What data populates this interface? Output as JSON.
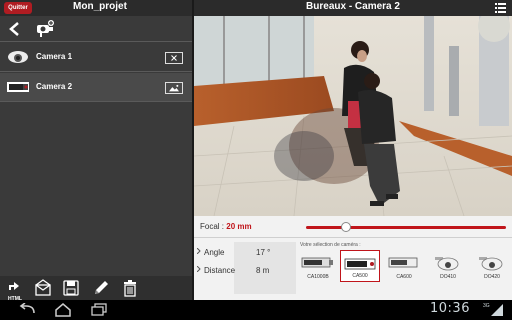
{
  "left_panel": {
    "quit_label": "Quitter",
    "project_title": "Mon_projet",
    "cameras": [
      {
        "name": "Camera 1",
        "icon": "dome-camera-icon",
        "action_icon": "close-box-icon"
      },
      {
        "name": "Camera 2",
        "icon": "bullet-camera-icon",
        "action_icon": "image-icon"
      }
    ],
    "bottom_tools": [
      {
        "icon": "html-export-icon",
        "label": "HTML"
      },
      {
        "icon": "email-icon"
      },
      {
        "icon": "save-icon"
      },
      {
        "icon": "pencil-icon"
      },
      {
        "icon": "trash-icon"
      }
    ]
  },
  "right_panel": {
    "title": "Bureaux - Camera 2",
    "focal": {
      "label": "Focal :",
      "value": "20 mm",
      "slider_fraction": 0.2
    },
    "params": [
      {
        "label": "Angle",
        "value": "17 °"
      },
      {
        "label": "Distance",
        "value": "8 m"
      }
    ],
    "camera_select_label": "Votre sélection de caméra :",
    "camera_options": [
      {
        "label": "CA1000B",
        "selected": false
      },
      {
        "label": "CA500",
        "selected": true
      },
      {
        "label": "CA600",
        "selected": false
      },
      {
        "label": "DO410",
        "selected": false
      },
      {
        "label": "DO420",
        "selected": false
      }
    ]
  },
  "status_bar": {
    "time": "10:36",
    "signal": "3G"
  },
  "colors": {
    "accent": "#c0151b",
    "panel_dark": "#3a3a3a",
    "title_bar": "#2b2b2b"
  }
}
